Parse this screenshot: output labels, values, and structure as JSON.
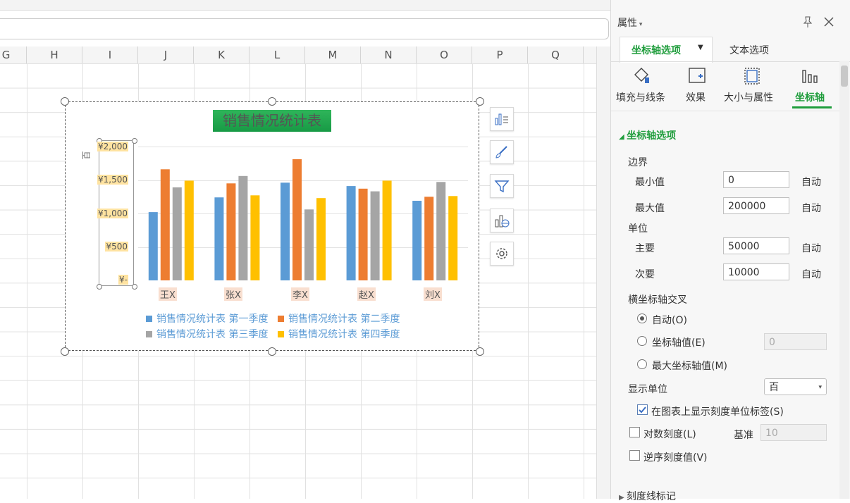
{
  "columns": [
    "G",
    "H",
    "I",
    "J",
    "K",
    "L",
    "M",
    "N",
    "O",
    "P",
    "Q"
  ],
  "chart_data": {
    "type": "bar",
    "title": "销售情况统计表",
    "ylabel": "百",
    "categories": [
      "王X",
      "张X",
      "李X",
      "赵X",
      "刘X"
    ],
    "series": [
      {
        "name": "销售情况统计表 第一季度",
        "color": "#5b9bd5",
        "values": [
          1020,
          1240,
          1460,
          1410,
          1190
        ]
      },
      {
        "name": "销售情况统计表 第二季度",
        "color": "#ed7d31",
        "values": [
          1660,
          1450,
          1810,
          1370,
          1250
        ]
      },
      {
        "name": "销售情况统计表 第三季度",
        "color": "#a5a5a5",
        "values": [
          1390,
          1560,
          1060,
          1330,
          1470
        ]
      },
      {
        "name": "销售情况统计表 第四季度",
        "color": "#ffc000",
        "values": [
          1490,
          1270,
          1230,
          1490,
          1260
        ]
      }
    ],
    "y_ticks": [
      "¥2,000",
      "¥1,500",
      "¥1,000",
      "¥500",
      "¥-"
    ],
    "ylim": [
      0,
      2000
    ],
    "legend_position": "bottom"
  },
  "panel": {
    "title": "属性",
    "tab_axis": "坐标轴选项",
    "tab_text": "文本选项",
    "sub_fill": "填充与线条",
    "sub_effect": "效果",
    "sub_size": "大小与属性",
    "sub_axis": "坐标轴",
    "section": "坐标轴选项",
    "bounds": "边界",
    "min_label": "最小值",
    "min_value": "0",
    "max_label": "最大值",
    "max_value": "200000",
    "auto": "自动",
    "unit": "单位",
    "major_label": "主要",
    "major_value": "50000",
    "minor_label": "次要",
    "minor_value": "10000",
    "cross": "横坐标轴交叉",
    "radio_auto": "自动(O)",
    "radio_value": "坐标轴值(E)",
    "radio_value_input": "0",
    "radio_max": "最大坐标轴值(M)",
    "display_unit": "显示单位",
    "display_unit_value": "百",
    "show_label": "在图表上显示刻度单位标签(S)",
    "log_scale": "对数刻度(L)",
    "base": "基准",
    "base_value": "10",
    "reverse": "逆序刻度值(V)",
    "tick_marks": "刻度线标记"
  }
}
